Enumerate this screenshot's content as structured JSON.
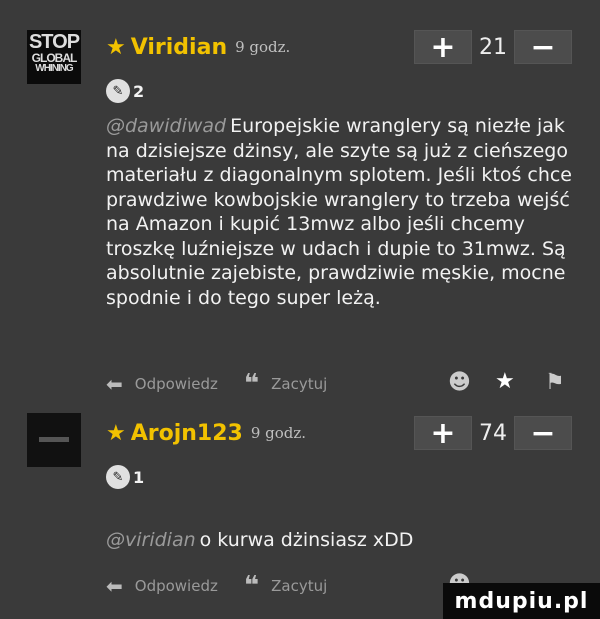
{
  "comments": [
    {
      "avatar_text": [
        "STOP",
        "GLOBAL",
        "WHINING"
      ],
      "username": "Viridian",
      "time": "9 godz.",
      "plus": "+",
      "minus": "−",
      "votes": "21",
      "badge_count": "2",
      "mention": "@dawidiwad",
      "text": "Europejskie wranglery są niezłe jak na dzisiejsze dżinsy, ale szyte są już z cieńszego materiału z diagonalnym splotem. Jeśli ktoś chce prawdziwe kowbojskie wranglery to trzeba wejść na Amazon i kupić 13mwz albo jeśli chcemy troszkę luźniejsze w udach i dupie to 31mwz. Są absolutnie zajebiste, prawdziwie męskie, mocne spodnie i do tego super leżą.",
      "reply_label": "Odpowiedz",
      "quote_label": "Zacytuj"
    },
    {
      "username": "Arojn123",
      "time": "9 godz.",
      "plus": "+",
      "minus": "−",
      "votes": "74",
      "badge_count": "1",
      "mention": "@viridian",
      "text": "o kurwa dżinsiasz xDD",
      "reply_label": "Odpowiedz",
      "quote_label": "Zacytuj"
    }
  ],
  "watermark": "mdupiu.pl"
}
